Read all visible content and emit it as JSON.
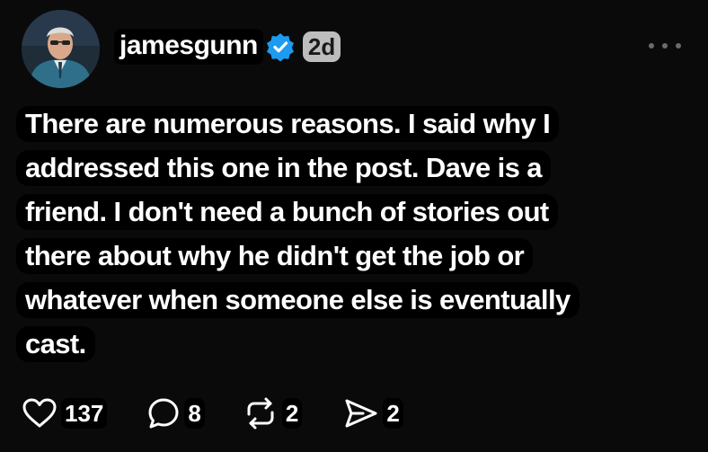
{
  "post": {
    "username": "jamesgunn",
    "time": "2d",
    "verified_icon": "verified-badge-icon",
    "lines": [
      "There are numerous reasons. I said why I",
      "addressed this one in the post. Dave is a",
      "friend. I don't need a bunch of stories out",
      "there about why he didn't get the job or",
      "whatever when someone else is eventually",
      "cast."
    ]
  },
  "actions": {
    "likes": "137",
    "replies": "8",
    "reposts": "2",
    "shares": "2"
  },
  "colors": {
    "background": "#0a0a0a",
    "text": "#ffffff",
    "verified": "#1d9bf0",
    "icon_gray": "#6b6b6b"
  }
}
